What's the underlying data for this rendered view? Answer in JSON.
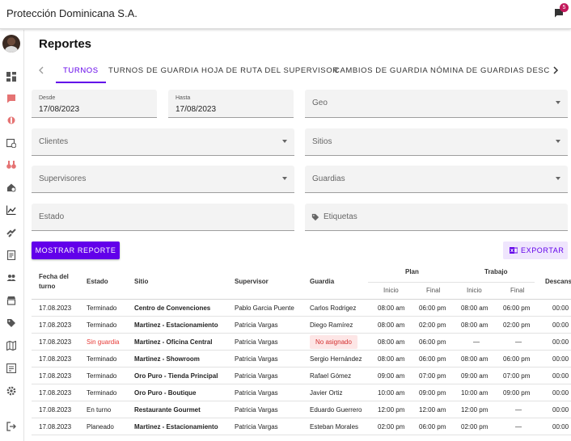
{
  "app": {
    "title": "Protección Dominicana S.A.",
    "notification_count": "5"
  },
  "page": {
    "title": "Reportes"
  },
  "tabs": [
    "TURNOS",
    "TURNOS DE GUARDIA",
    "HOJA DE RUTA DEL SUPERVISOR",
    "CAMBIOS DE GUARDIA",
    "NÓMINA DE GUARDIAS",
    "DESC"
  ],
  "filters": {
    "desde_label": "Desde",
    "desde_value": "17/08/2023",
    "hasta_label": "Hasta",
    "hasta_value": "17/08/2023",
    "geo": "Geo",
    "clientes": "Clientes",
    "sitios": "Sitios",
    "supervisores": "Supervisores",
    "guardias": "Guardias",
    "estado": "Estado",
    "etiquetas": "Etiquetas"
  },
  "actions": {
    "show_report": "MOSTRAR REPORTE",
    "export": "EXPORTAR"
  },
  "table": {
    "headers": {
      "fecha": "Fecha del turno",
      "estado": "Estado",
      "sitio": "Sitio",
      "supervisor": "Supervisor",
      "guardia": "Guardia",
      "plan": "Plan",
      "trabajo": "Trabajo",
      "inicio": "Inicio",
      "final": "Final",
      "descanso": "Descans"
    },
    "rows": [
      {
        "fecha": "17.08.2023",
        "estado": "Terminado",
        "sitio": "Centro de Convenciones",
        "supervisor": "Pablo Garcia Puente",
        "guardia": "Carlos Rodrigez",
        "plan_inicio": "08:00 am",
        "plan_final": "06:00 pm",
        "trab_inicio": "08:00 am",
        "trab_final": "06:00 pm",
        "descanso": "00:00"
      },
      {
        "fecha": "17.08.2023",
        "estado": "Terminado",
        "sitio": "Martinez - Estacionamiento",
        "supervisor": "Patricia Vargas",
        "guardia": "Diego Ramírez",
        "plan_inicio": "08:00 am",
        "plan_final": "02:00 pm",
        "trab_inicio": "08:00 am",
        "trab_final": "02:00 pm",
        "descanso": "00:00"
      },
      {
        "fecha": "17.08.2023",
        "estado": "Sin guardia",
        "sitio": "Martinez - Oficina Central",
        "supervisor": "Patricia Vargas",
        "guardia": "No asignado",
        "plan_inicio": "08:00 am",
        "plan_final": "06:00 pm",
        "trab_inicio": "—",
        "trab_final": "—",
        "descanso": "00:00"
      },
      {
        "fecha": "17.08.2023",
        "estado": "Terminado",
        "sitio": "Martinez - Showroom",
        "supervisor": "Patricia Vargas",
        "guardia": "Sergio Hernández",
        "plan_inicio": "08:00 am",
        "plan_final": "06:00 pm",
        "trab_inicio": "08:00 am",
        "trab_final": "06:00 pm",
        "descanso": "00:00"
      },
      {
        "fecha": "17.08.2023",
        "estado": "Terminado",
        "sitio": "Oro Puro - Tienda Principal",
        "supervisor": "Patricia Vargas",
        "guardia": "Rafael Gómez",
        "plan_inicio": "09:00 am",
        "plan_final": "07:00 pm",
        "trab_inicio": "09:00 am",
        "trab_final": "07:00 pm",
        "descanso": "00:00"
      },
      {
        "fecha": "17.08.2023",
        "estado": "Terminado",
        "sitio": "Oro Puro - Boutique",
        "supervisor": "Patricia Vargas",
        "guardia": "Javier Ortiz",
        "plan_inicio": "10:00 am",
        "plan_final": "09:00 pm",
        "trab_inicio": "10:00 am",
        "trab_final": "09:00 pm",
        "descanso": "00:00"
      },
      {
        "fecha": "17.08.2023",
        "estado": "En turno",
        "sitio": "Restaurante Gourmet",
        "supervisor": "Patricia Vargas",
        "guardia": "Eduardo Guerrero",
        "plan_inicio": "12:00 pm",
        "plan_final": "12:00 am",
        "trab_inicio": "12:00 pm",
        "trab_final": "—",
        "descanso": "00:00"
      },
      {
        "fecha": "17.08.2023",
        "estado": "Planeado",
        "sitio": "Martinez - Estacionamiento",
        "supervisor": "Patricia Vargas",
        "guardia": "Esteban Morales",
        "plan_inicio": "02:00 pm",
        "plan_final": "06:00 pm",
        "trab_inicio": "02:00 pm",
        "trab_final": "—",
        "descanso": "00:00"
      }
    ]
  },
  "colors": {
    "accent": "#6200ea",
    "danger": "#e53935",
    "field_bg": "#f3f3f3"
  }
}
